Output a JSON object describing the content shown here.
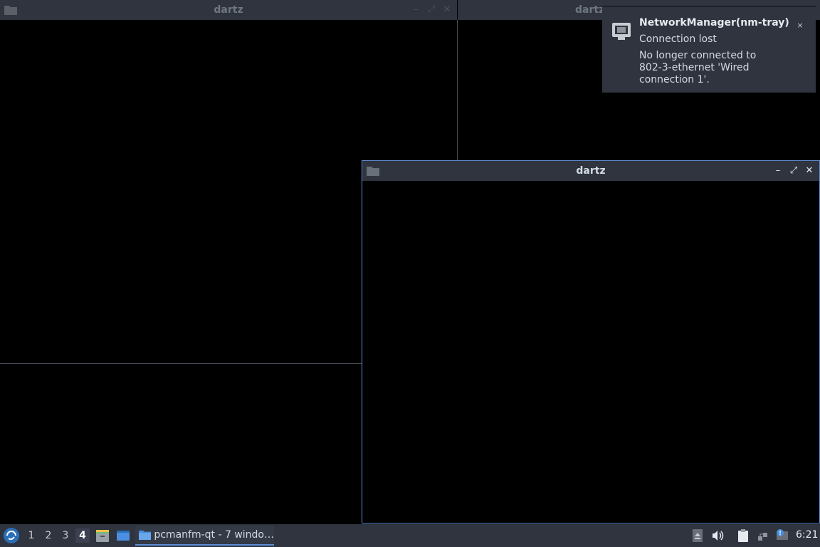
{
  "windows": {
    "bg_left": {
      "title": "dartz"
    },
    "bg_right": {
      "title": "dartz"
    },
    "front": {
      "title": "dartz",
      "buttons": {
        "minimize": "–",
        "maximize": "⤢",
        "close": "✕"
      }
    }
  },
  "notification": {
    "app": "NetworkManager(nm-tray)",
    "summary": "Connection lost",
    "body": "No longer connected to 802-3-ethernet 'Wired connection 1'.",
    "close": "×"
  },
  "taskbar": {
    "workspaces": [
      "1",
      "2",
      "3",
      "4"
    ],
    "current_workspace": "4",
    "task_label": "pcmanfm-qt - 7 windo…",
    "clock": "6:21"
  },
  "colors": {
    "accent": "#5e8fd6",
    "panel": "#2f343f",
    "desktop": "#000000"
  }
}
